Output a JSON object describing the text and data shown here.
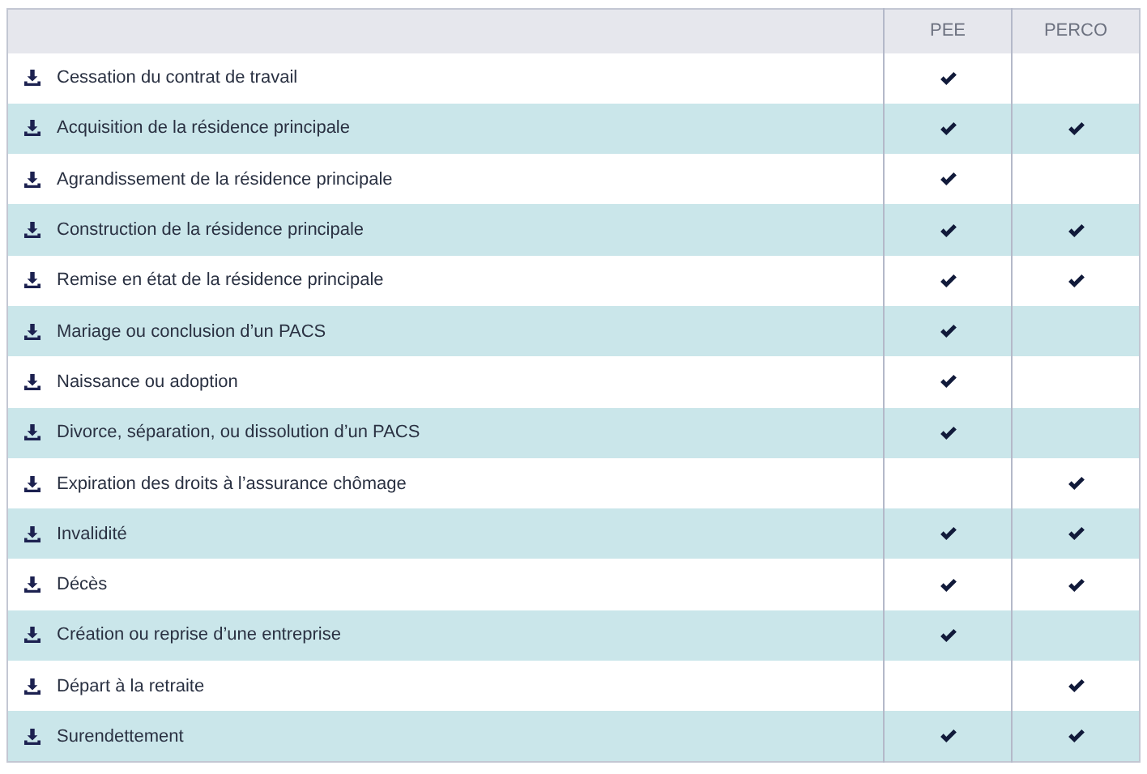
{
  "table": {
    "columns": [
      "PEE",
      "PERCO"
    ],
    "rows": [
      {
        "label": "Cessation du contrat de travail",
        "pee": true,
        "perco": false
      },
      {
        "label": "Acquisition de la résidence principale",
        "pee": true,
        "perco": true
      },
      {
        "label": "Agrandissement de la résidence principale",
        "pee": true,
        "perco": false
      },
      {
        "label": "Construction de la résidence principale",
        "pee": true,
        "perco": true
      },
      {
        "label": "Remise en état de la résidence principale",
        "pee": true,
        "perco": true
      },
      {
        "label": "Mariage ou conclusion d’un PACS",
        "pee": true,
        "perco": false
      },
      {
        "label": "Naissance ou adoption",
        "pee": true,
        "perco": false
      },
      {
        "label": "Divorce, séparation, ou dissolution d’un PACS",
        "pee": true,
        "perco": false
      },
      {
        "label": "Expiration des droits à l’assurance chômage",
        "pee": false,
        "perco": true
      },
      {
        "label": "Invalidité",
        "pee": true,
        "perco": true
      },
      {
        "label": "Décès",
        "pee": true,
        "perco": true
      },
      {
        "label": "Création ou reprise d’une entreprise",
        "pee": true,
        "perco": false
      },
      {
        "label": "Départ à la retraite",
        "pee": false,
        "perco": true
      },
      {
        "label": "Surendettement",
        "pee": true,
        "perco": true
      }
    ]
  }
}
